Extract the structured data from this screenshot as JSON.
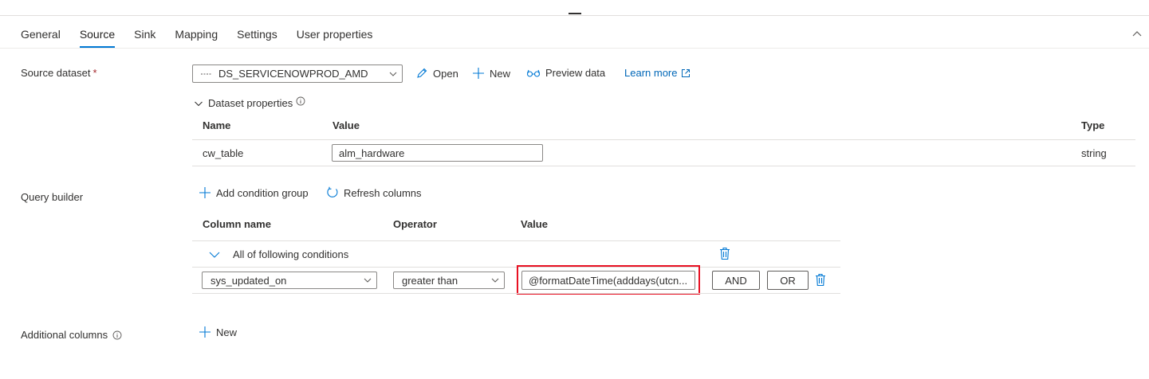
{
  "tabs": [
    {
      "label": "General"
    },
    {
      "label": "Source"
    },
    {
      "label": "Sink"
    },
    {
      "label": "Mapping"
    },
    {
      "label": "Settings"
    },
    {
      "label": "User properties"
    }
  ],
  "source_dataset": {
    "label": "Source dataset",
    "required_mark": "*",
    "selected": "DS_SERVICENOWPROD_AMD",
    "open_label": "Open",
    "new_label": "New",
    "preview_label": "Preview data",
    "learn_more_label": "Learn more"
  },
  "dataset_properties": {
    "title": "Dataset properties",
    "columns": {
      "name": "Name",
      "value": "Value",
      "type": "Type"
    },
    "rows": [
      {
        "name": "cw_table",
        "value": "alm_hardware",
        "type": "string"
      }
    ]
  },
  "query_builder": {
    "label": "Query builder",
    "add_group_label": "Add condition group",
    "refresh_label": "Refresh columns",
    "columns": {
      "column_name": "Column name",
      "operator": "Operator",
      "value": "Value"
    },
    "group_label": "All of following conditions",
    "condition": {
      "column": "sys_updated_on",
      "operator": "greater than",
      "value": "@formatDateTime(adddays(utcn...",
      "and_label": "AND",
      "or_label": "OR"
    }
  },
  "additional_columns": {
    "label": "Additional columns",
    "new_label": "New"
  },
  "colors": {
    "accent": "#0078d4",
    "highlight": "#e81123",
    "link": "#0067b8"
  }
}
